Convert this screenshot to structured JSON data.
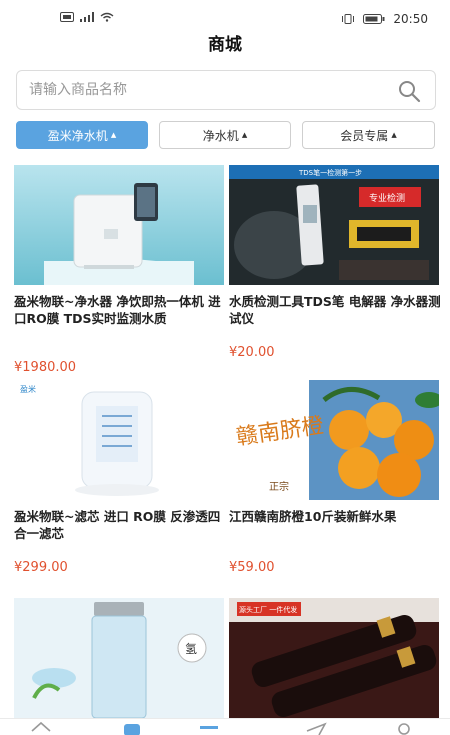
{
  "status_bar": {
    "time": "20:50",
    "sim_icon": "sim-icon",
    "signal_icon": "signal-icon",
    "wifi_icon": "wifi-icon",
    "vibrate_icon": "vibrate-icon",
    "battery_icon": "battery-icon"
  },
  "header": {
    "title": "商城"
  },
  "search": {
    "placeholder": "请输入商品名称",
    "value": "",
    "icon": "search-icon"
  },
  "filters": [
    {
      "label": "盈米净水机",
      "active": true
    },
    {
      "label": "净水机",
      "active": false
    },
    {
      "label": "会员专属",
      "active": false
    }
  ],
  "products": [
    {
      "name": "盈米物联~净水器 净饮即热一体机 进口RO膜 TDS实时监测水质",
      "price": "¥1980.00"
    },
    {
      "name": "水质检测工具TDS笔 电解器 净水器测试仪",
      "price": "¥20.00"
    },
    {
      "name": "盈米物联~滤芯 进口 RO膜 反渗透四合一滤芯",
      "price": "¥299.00"
    },
    {
      "name": "江西赣南脐橙10斤装新鲜水果",
      "price": "¥59.00"
    },
    {
      "name": "",
      "price": ""
    },
    {
      "name": "",
      "price": ""
    }
  ],
  "image_text": {
    "tds_banner": "TDS笔一检测第一步",
    "tds_sign": "专业检测",
    "orange_title": "赣南脐橙",
    "orange_sub": "正宗",
    "wine_tag": "源头工厂 一件代发",
    "filter_logo": "盈米",
    "cup_char": "氢"
  },
  "tabbar": {
    "icons": [
      "home-icon",
      "list-icon",
      "shop-icon",
      "send-icon",
      "user-icon"
    ]
  },
  "colors": {
    "accent": "#5aa3e0",
    "price": "#e0512f"
  }
}
